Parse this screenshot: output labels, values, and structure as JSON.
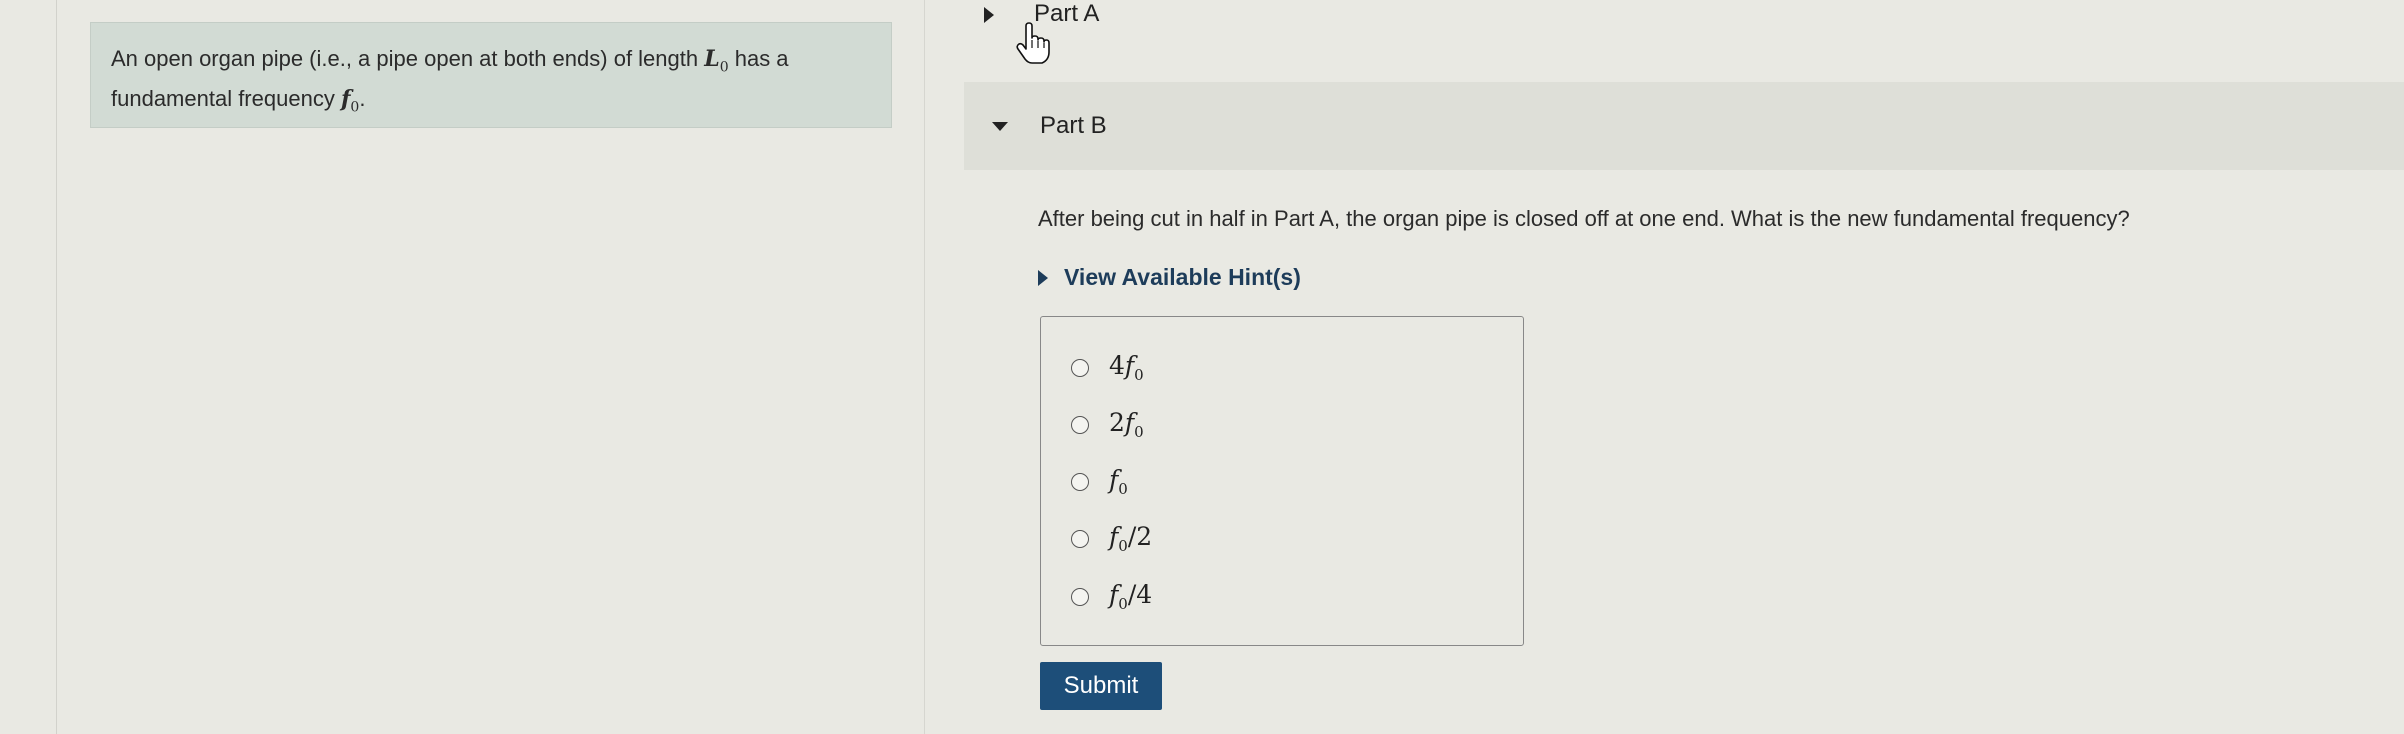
{
  "problem": {
    "text_before": "An open organ pipe (i.e., a pipe open at both ends) of length ",
    "length_symbol": "L",
    "length_sub": "0",
    "text_middle": " has a fundamental frequency ",
    "freq_symbol": "f",
    "freq_sub": "0",
    "text_end": "."
  },
  "part_a": {
    "label": "Part A"
  },
  "part_b": {
    "label": "Part B",
    "question": "After being cut in half in Part A, the organ pipe is closed off at one end. What is the new fundamental frequency?",
    "hint_label": "View Available Hint(s)",
    "options": [
      {
        "prefix": "4",
        "symbol": "f",
        "sub": "0",
        "suffix": ""
      },
      {
        "prefix": "2",
        "symbol": "f",
        "sub": "0",
        "suffix": ""
      },
      {
        "prefix": "",
        "symbol": "f",
        "sub": "0",
        "suffix": ""
      },
      {
        "prefix": "",
        "symbol": "f",
        "sub": "0",
        "suffix": "/2"
      },
      {
        "prefix": "",
        "symbol": "f",
        "sub": "0",
        "suffix": "/4"
      }
    ],
    "submit_label": "Submit"
  },
  "colors": {
    "submit_bg": "#1d4e79",
    "hint_text": "#1d3c5a",
    "problem_bg": "#d2dbd4"
  }
}
